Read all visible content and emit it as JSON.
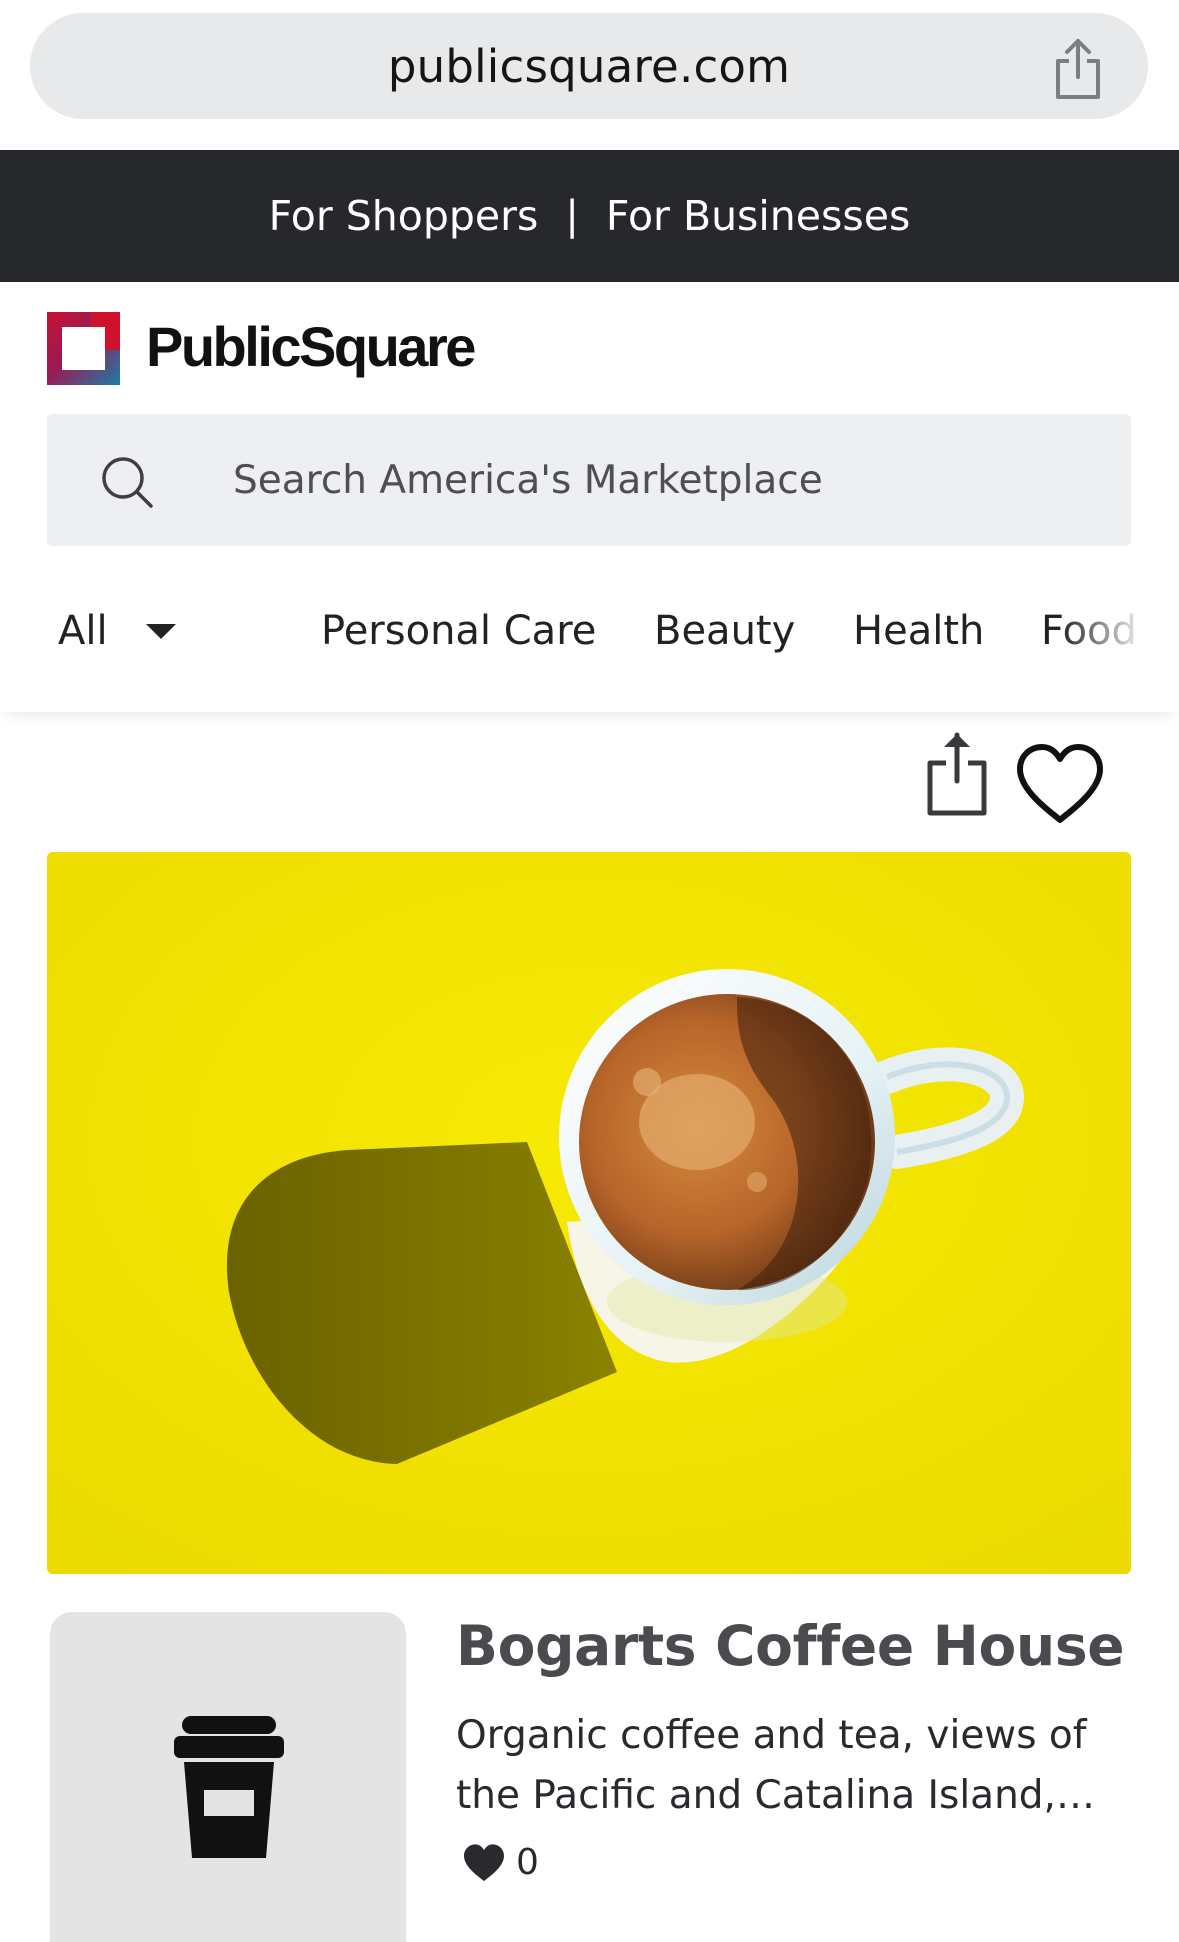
{
  "browser": {
    "url": "publicsquare.com",
    "share_icon": "share-icon"
  },
  "audience_bar": {
    "shoppers_label": "For Shoppers",
    "separator": "|",
    "businesses_label": "For Businesses"
  },
  "brand": {
    "name": "PublicSquare",
    "logo_icon": "publicsquare-logo",
    "colors": {
      "red": "#c8102e",
      "blue": "#1b7ea8"
    }
  },
  "search": {
    "placeholder": "Search America's Marketplace",
    "value": "",
    "icon": "search-icon"
  },
  "categories": {
    "selected": "All",
    "items": [
      "Personal Care",
      "Beauty",
      "Health",
      "Food"
    ]
  },
  "actions": {
    "share_icon": "share-icon",
    "favorite_icon": "heart-outline-icon"
  },
  "hero": {
    "description": "espresso cup on yellow background",
    "background_color": "#f1e200"
  },
  "business": {
    "name": "Bogarts Coffee House",
    "description": "Organic coffee and tea, views of the Pacific and Catalina Island, sandwiches, pastries and more",
    "likes": "0",
    "thumbnail_icon": "coffee-cup-icon",
    "like_icon": "heart-filled-icon"
  }
}
